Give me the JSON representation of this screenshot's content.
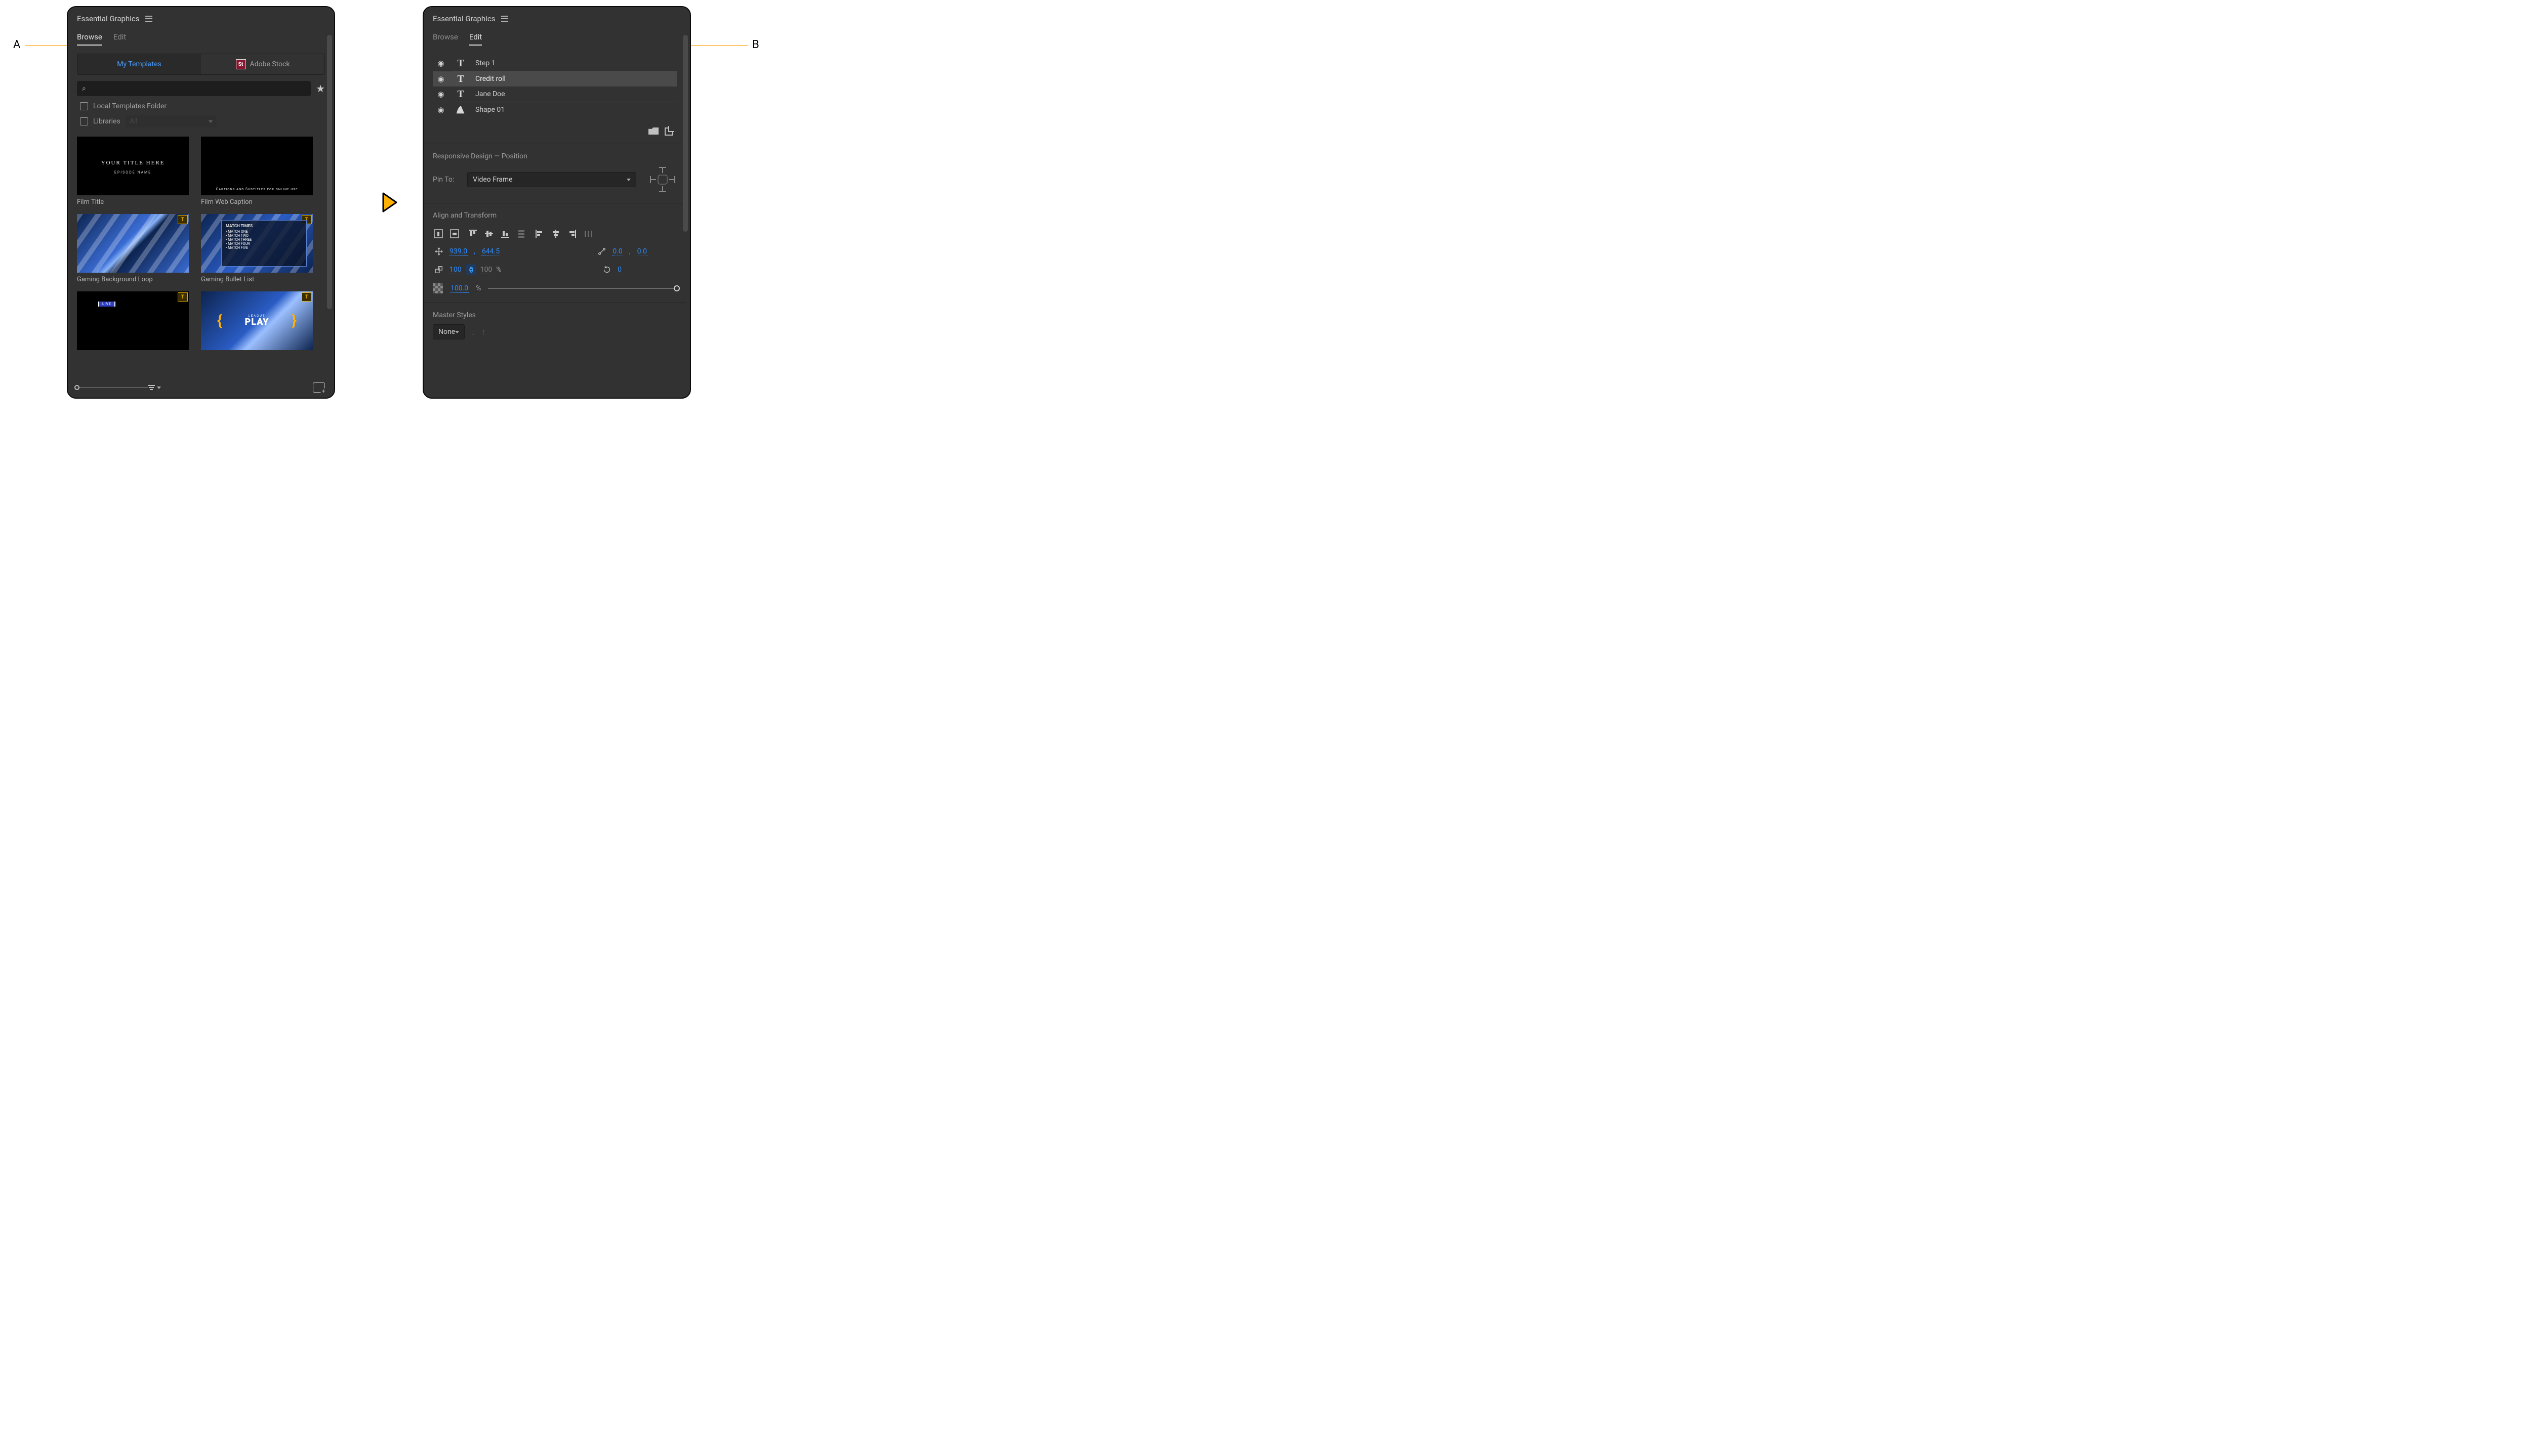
{
  "callouts": {
    "a": "A",
    "b": "B"
  },
  "panel": {
    "title": "Essential Graphics",
    "tabs": {
      "browse": "Browse",
      "edit": "Edit"
    }
  },
  "browse": {
    "sources": {
      "my_templates": "My Templates",
      "adobe_stock": "Adobe Stock",
      "st_badge": "St"
    },
    "filters": {
      "local": "Local Templates Folder",
      "libraries": "Libraries",
      "libraries_dd": "All"
    },
    "templates": [
      {
        "name": "Film Title",
        "line1": "YOUR TITLE HERE",
        "line2": "EPISODE NAME"
      },
      {
        "name": "Film Web Caption",
        "line1": "Captions and Subtitles for online use"
      },
      {
        "name": "Gaming Background Loop"
      },
      {
        "name": "Gaming Bullet List",
        "heading": "MATCH TIMES",
        "bullets": [
          "MATCH ONE",
          "MATCH TWO",
          "MATCH THREE",
          "MATCH FOUR",
          "MATCH FIVE"
        ]
      },
      {
        "name": "",
        "tag": "LIVE"
      },
      {
        "name": "",
        "word_small": "LEAGUE",
        "word_big": "PLAY"
      }
    ]
  },
  "edit": {
    "layers": [
      {
        "name": "Step 1",
        "type": "text",
        "selected": false
      },
      {
        "name": "Credit roll",
        "type": "text",
        "selected": true
      },
      {
        "name": "Jane Doe",
        "type": "text",
        "selected": false
      },
      {
        "name": "Shape 01",
        "type": "shape",
        "selected": false
      }
    ],
    "responsive": {
      "title": "Responsive Design — Position",
      "pin_label": "Pin To:",
      "pin_value": "Video Frame"
    },
    "align": {
      "title": "Align and Transform"
    },
    "transform": {
      "pos_x": "939.0",
      "pos_y": "644.5",
      "anchor_x": "0.0",
      "anchor_y": "0.0",
      "scale_w": "100",
      "scale_h": "100",
      "scale_unit": "%",
      "rotation": "0",
      "opacity": "100.0",
      "opacity_unit": "%"
    },
    "master": {
      "title": "Master Styles",
      "value": "None"
    }
  }
}
